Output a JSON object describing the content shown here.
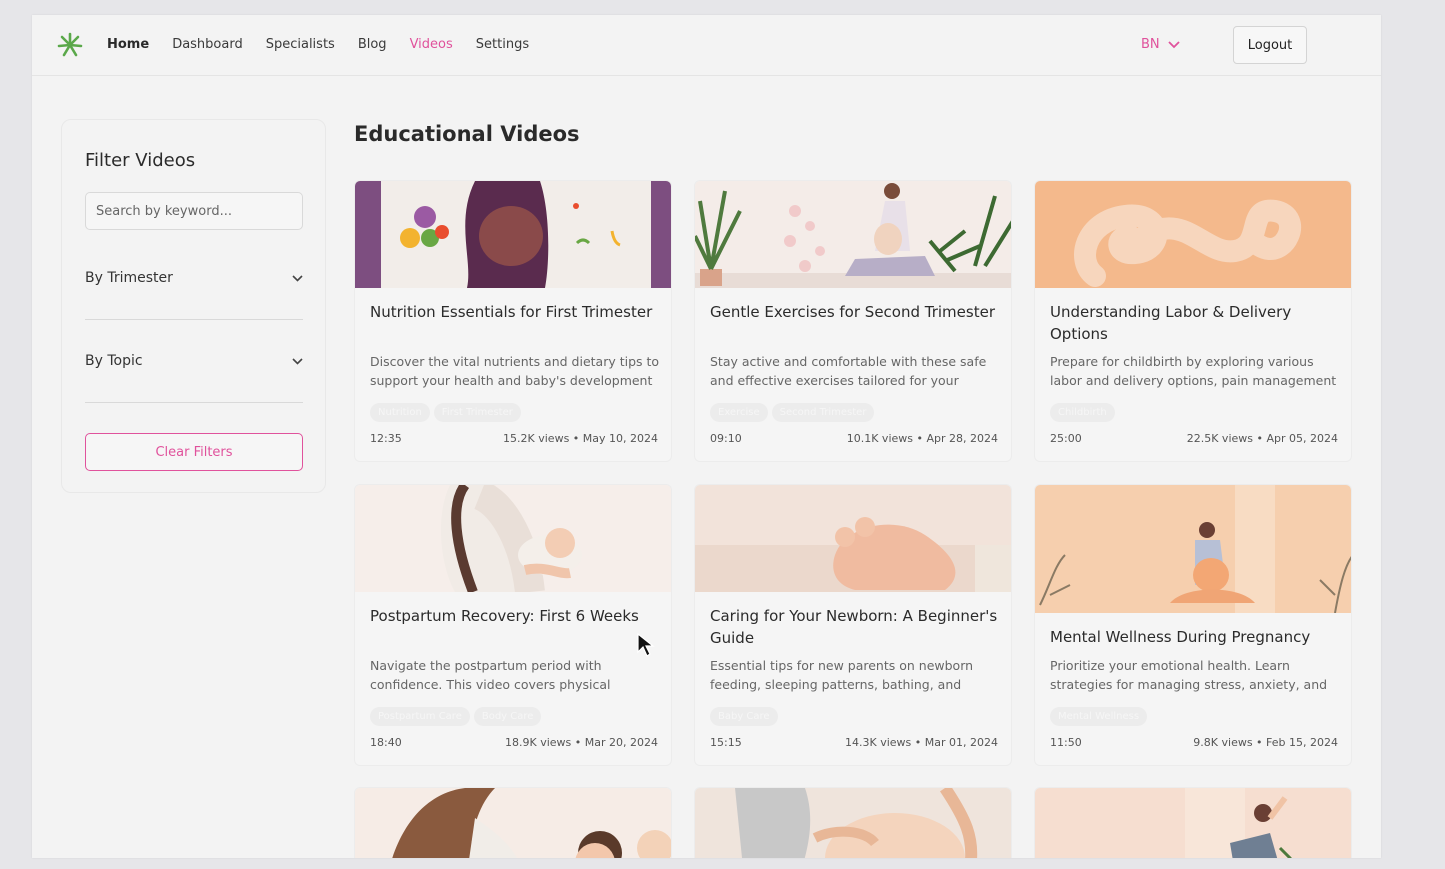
{
  "nav": {
    "links": [
      {
        "label": "Home",
        "key": "home"
      },
      {
        "label": "Dashboard",
        "key": "dashboard"
      },
      {
        "label": "Specialists",
        "key": "specialists"
      },
      {
        "label": "Blog",
        "key": "blog"
      },
      {
        "label": "Videos",
        "key": "videos"
      },
      {
        "label": "Settings",
        "key": "settings"
      }
    ],
    "active": "videos",
    "language": "BN",
    "logout_label": "Logout"
  },
  "sidebar": {
    "title": "Filter Videos",
    "search_placeholder": "Search by keyword...",
    "trimester_label": "By Trimester",
    "topic_label": "By Topic",
    "clear_label": "Clear Filters"
  },
  "main": {
    "title": "Educational Videos",
    "videos": [
      {
        "title": "Nutrition Essentials for First Trimester",
        "desc": "Discover the vital nutrients and dietary tips to support your health and baby's development",
        "tags": [
          "Nutrition",
          "First Trimester"
        ],
        "duration": "12:35",
        "stats": "15.2K views • May 10, 2024",
        "thumb": "nutrition"
      },
      {
        "title": "Gentle Exercises for Second Trimester",
        "desc": "Stay active and comfortable with these safe and effective exercises tailored for your",
        "tags": [
          "Exercise",
          "Second Trimester"
        ],
        "duration": "09:10",
        "stats": "10.1K views • Apr 28, 2024",
        "thumb": "exercise"
      },
      {
        "title": "Understanding Labor & Delivery Options",
        "desc": "Prepare for childbirth by exploring various labor and delivery options, pain management",
        "tags": [
          "Childbirth"
        ],
        "duration": "25:00",
        "stats": "22.5K views • Apr 05, 2024",
        "thumb": "labor"
      },
      {
        "title": "Postpartum Recovery: First 6 Weeks",
        "desc": "Navigate the postpartum period with confidence. This video covers physical",
        "tags": [
          "Postpartum Care",
          "Body Care"
        ],
        "duration": "18:40",
        "stats": "18.9K views • Mar 20, 2024",
        "thumb": "postpartum"
      },
      {
        "title": "Caring for Your Newborn: A Beginner's Guide",
        "desc": "Essential tips for new parents on newborn feeding, sleeping patterns, bathing, and",
        "tags": [
          "Baby Care"
        ],
        "duration": "15:15",
        "stats": "14.3K views • Mar 01, 2024",
        "thumb": "newborn"
      },
      {
        "title": "Mental Wellness During Pregnancy",
        "desc": "Prioritize your emotional health. Learn strategies for managing stress, anxiety, and",
        "tags": [
          "Mental Wellness"
        ],
        "duration": "11:50",
        "stats": "9.8K views • Feb 15, 2024",
        "thumb": "wellness"
      },
      {
        "title": "",
        "desc": "",
        "tags": [],
        "duration": "",
        "stats": "",
        "thumb": "mother"
      },
      {
        "title": "",
        "desc": "",
        "tags": [],
        "duration": "",
        "stats": "",
        "thumb": "bump"
      },
      {
        "title": "",
        "desc": "",
        "tags": [],
        "duration": "",
        "stats": "",
        "thumb": "yoga"
      }
    ]
  },
  "colors": {
    "accent": "#e0529c",
    "logo_green": "#5aa84a"
  }
}
